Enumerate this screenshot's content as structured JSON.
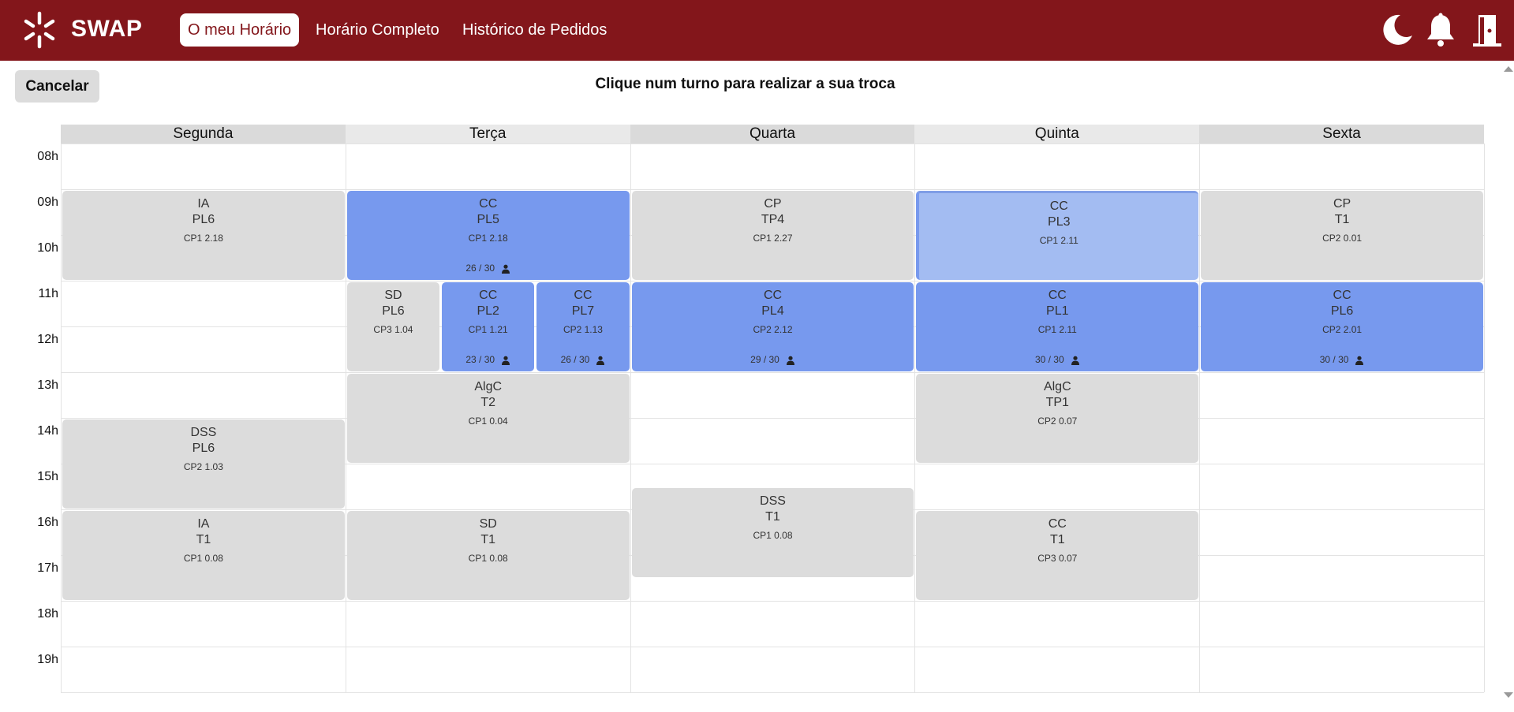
{
  "app": {
    "brand": "SWAP",
    "header_color": "#83161b"
  },
  "nav": {
    "items": [
      "O meu Horário",
      "Horário Completo",
      "Histórico de Pedidos"
    ],
    "active": "O meu Horário"
  },
  "header_icons": [
    "moon-icon",
    "bell-icon",
    "logout-door-icon"
  ],
  "toolbar": {
    "cancel_label": "Cancelar",
    "instruction": "Clique num turno para realizar a sua troca"
  },
  "calendar": {
    "days": [
      "Segunda",
      "Terça",
      "Quarta",
      "Quinta",
      "Sexta"
    ],
    "hours": [
      "08h",
      "09h",
      "10h",
      "11h",
      "12h",
      "13h",
      "14h",
      "15h",
      "16h",
      "17h",
      "18h",
      "19h"
    ],
    "colors": {
      "selectable": "#7799ee",
      "current": "#a3bcf2",
      "default": "#dcdcdc"
    },
    "events": [
      {
        "day": "Segunda",
        "subject": "IA",
        "shift": "PL6",
        "room": "CP1 2.18",
        "start": "09:00",
        "end": "11:00",
        "style": "default"
      },
      {
        "day": "Segunda",
        "subject": "DSS",
        "shift": "PL6",
        "room": "CP2 1.03",
        "start": "14:00",
        "end": "16:00",
        "style": "default"
      },
      {
        "day": "Segunda",
        "subject": "IA",
        "shift": "T1",
        "room": "CP1 0.08",
        "start": "16:00",
        "end": "18:00",
        "style": "default"
      },
      {
        "day": "Terça",
        "subject": "CC",
        "shift": "PL5",
        "room": "CP1 2.18",
        "start": "09:00",
        "end": "11:00",
        "style": "selectable",
        "capacity": "26 / 30"
      },
      {
        "day": "Terça",
        "subject": "SD",
        "shift": "PL6",
        "room": "CP3 1.04",
        "start": "11:00",
        "end": "13:00",
        "style": "default"
      },
      {
        "day": "Terça",
        "subject": "CC",
        "shift": "PL2",
        "room": "CP1 1.21",
        "start": "11:00",
        "end": "13:00",
        "style": "selectable",
        "capacity": "23 / 30"
      },
      {
        "day": "Terça",
        "subject": "CC",
        "shift": "PL7",
        "room": "CP2 1.13",
        "start": "11:00",
        "end": "13:00",
        "style": "selectable",
        "capacity": "26 / 30"
      },
      {
        "day": "Terça",
        "subject": "AlgC",
        "shift": "T2",
        "room": "CP1 0.04",
        "start": "13:00",
        "end": "15:00",
        "style": "default"
      },
      {
        "day": "Terça",
        "subject": "SD",
        "shift": "T1",
        "room": "CP1 0.08",
        "start": "16:00",
        "end": "18:00",
        "style": "default"
      },
      {
        "day": "Quarta",
        "subject": "CP",
        "shift": "TP4",
        "room": "CP1 2.27",
        "start": "09:00",
        "end": "11:00",
        "style": "default"
      },
      {
        "day": "Quarta",
        "subject": "CC",
        "shift": "PL4",
        "room": "CP2 2.12",
        "start": "11:00",
        "end": "13:00",
        "style": "selectable",
        "capacity": "29 / 30"
      },
      {
        "day": "Quarta",
        "subject": "DSS",
        "shift": "T1",
        "room": "CP1 0.08",
        "start": "15:30",
        "end": "17:30",
        "style": "default"
      },
      {
        "day": "Quinta",
        "subject": "CC",
        "shift": "PL3",
        "room": "CP1 2.11",
        "start": "09:00",
        "end": "11:00",
        "style": "current"
      },
      {
        "day": "Quinta",
        "subject": "CC",
        "shift": "PL1",
        "room": "CP1 2.11",
        "start": "11:00",
        "end": "13:00",
        "style": "selectable",
        "capacity": "30 / 30"
      },
      {
        "day": "Quinta",
        "subject": "AlgC",
        "shift": "TP1",
        "room": "CP2 0.07",
        "start": "13:00",
        "end": "15:00",
        "style": "default"
      },
      {
        "day": "Quinta",
        "subject": "CC",
        "shift": "T1",
        "room": "CP3 0.07",
        "start": "16:00",
        "end": "18:00",
        "style": "default"
      },
      {
        "day": "Sexta",
        "subject": "CP",
        "shift": "T1",
        "room": "CP2 0.01",
        "start": "09:00",
        "end": "11:00",
        "style": "default"
      },
      {
        "day": "Sexta",
        "subject": "CC",
        "shift": "PL6",
        "room": "CP2 2.01",
        "start": "11:00",
        "end": "13:00",
        "style": "selectable",
        "capacity": "30 / 30"
      }
    ]
  }
}
